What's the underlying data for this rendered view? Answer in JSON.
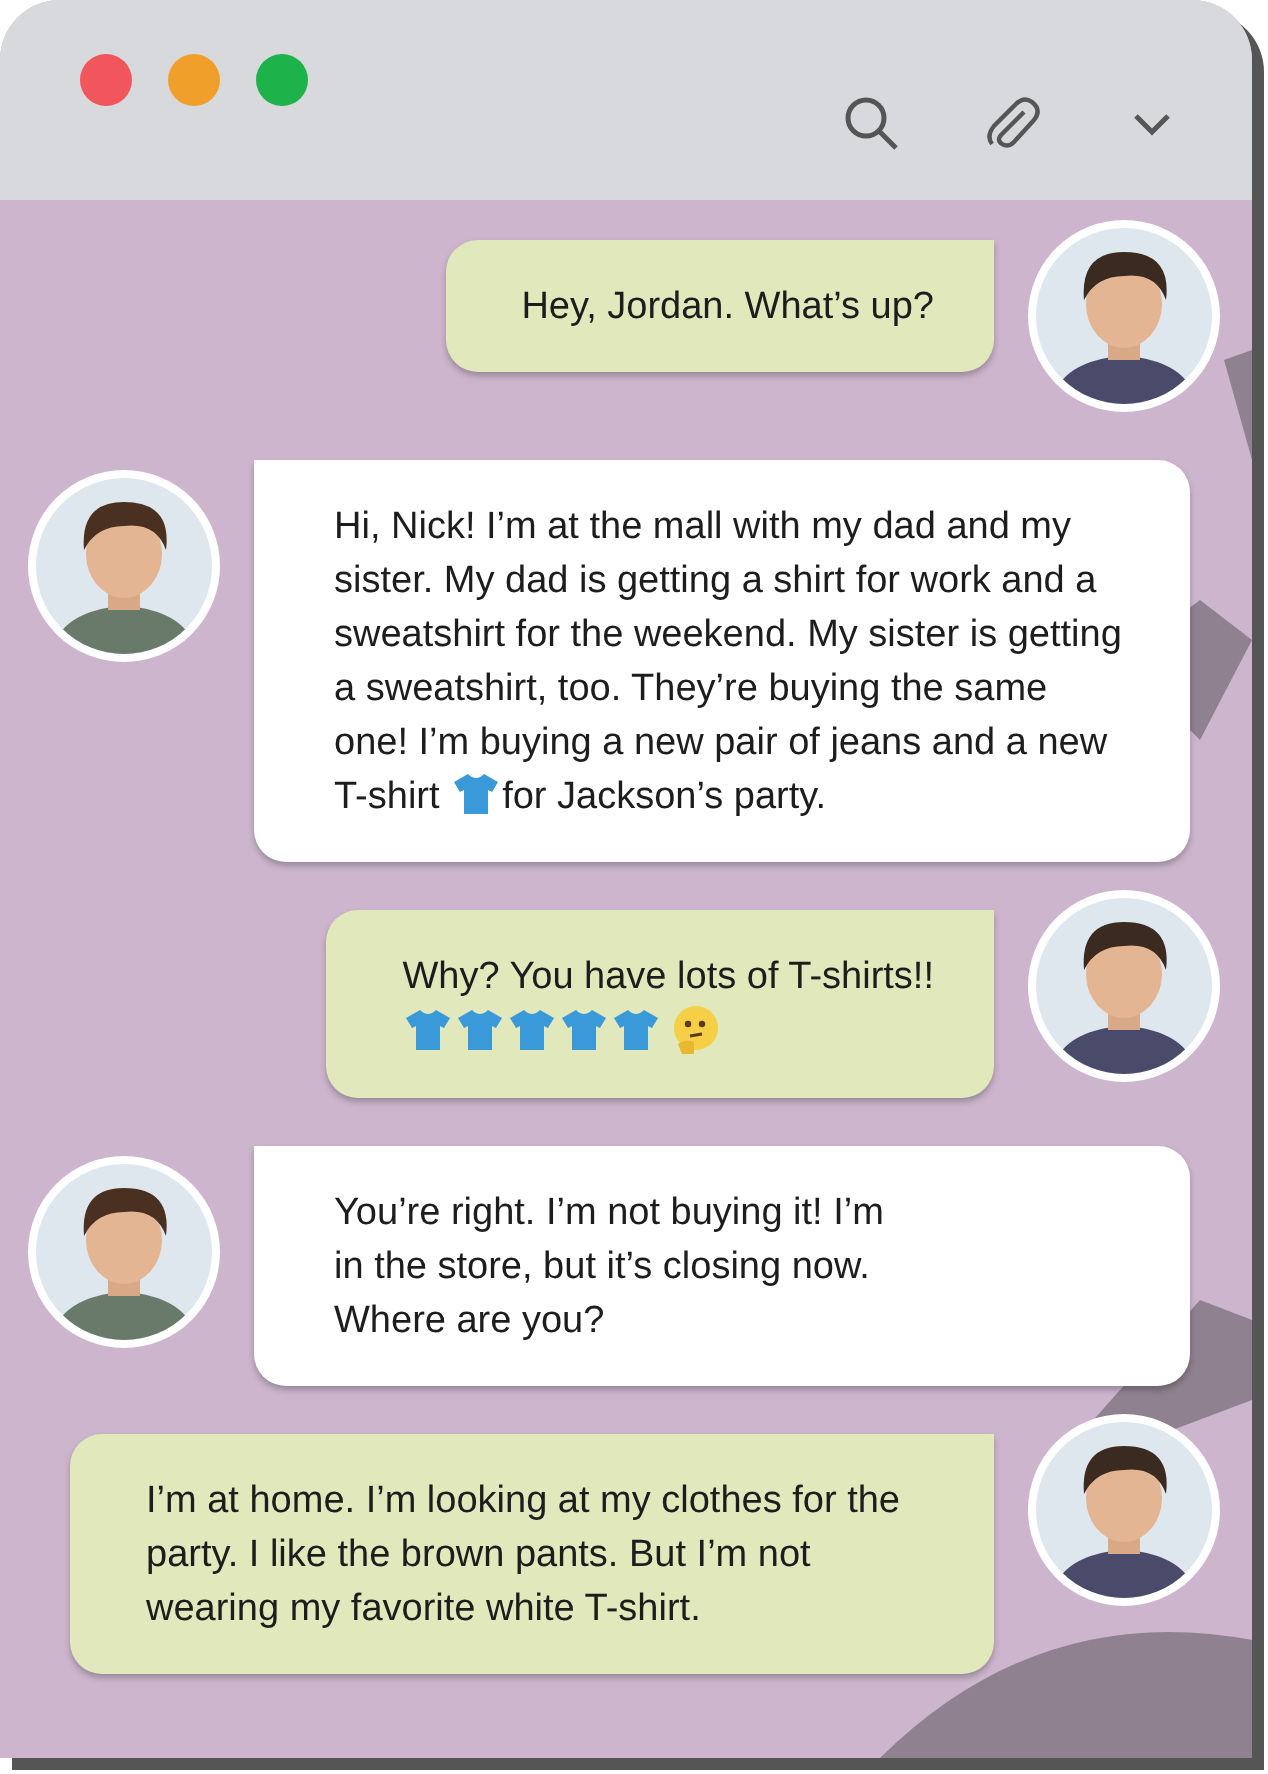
{
  "messages": [
    {
      "kind": "sent",
      "parts": [
        {
          "kind": "text",
          "text": "Hey, Jordan. What’s up?"
        }
      ]
    },
    {
      "kind": "received",
      "parts": [
        {
          "kind": "text",
          "text": "Hi, Nick! I’m at the mall with my dad and my sister. My dad is getting a shirt for work and a sweatshirt for the weekend. My sister is getting a sweatshirt, too. They’re buying the same one! I’m buying a new pair of jeans and a new T-shirt"
        },
        {
          "kind": "shirt"
        },
        {
          "kind": "text",
          "text": "for Jackson’s party."
        }
      ]
    },
    {
      "kind": "sent",
      "parts": [
        {
          "kind": "text",
          "text": "Why? You have lots of T-shirts!!"
        },
        {
          "kind": "break"
        },
        {
          "kind": "shirt"
        },
        {
          "kind": "shirt"
        },
        {
          "kind": "shirt"
        },
        {
          "kind": "shirt"
        },
        {
          "kind": "shirt"
        },
        {
          "kind": "thinking"
        }
      ]
    },
    {
      "kind": "received",
      "parts": [
        {
          "kind": "text",
          "text": "You’re right. I’m not buying it! I’m"
        },
        {
          "kind": "break"
        },
        {
          "kind": "text",
          "text": "in the store, but it’s closing now."
        },
        {
          "kind": "break"
        },
        {
          "kind": "text",
          "text": "Where are you?"
        }
      ]
    },
    {
      "kind": "sent",
      "parts": [
        {
          "kind": "text",
          "text": "I’m at home. I’m looking at my clothes for the party. I like the brown pants. But I’m not wearing my favorite white T-shirt."
        }
      ]
    }
  ]
}
